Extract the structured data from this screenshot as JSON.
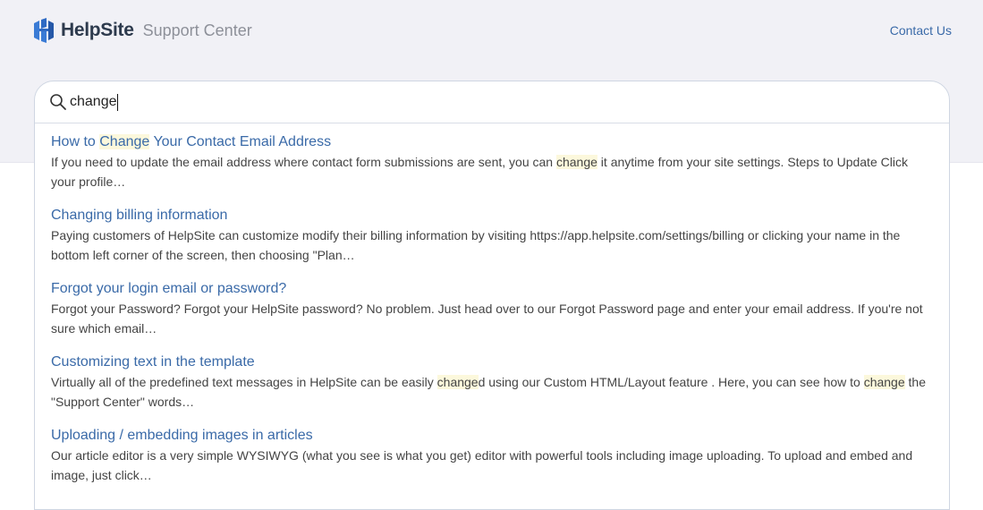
{
  "header": {
    "brand": "HelpSite",
    "subtitle": "Support Center",
    "contact_label": "Contact Us",
    "logo_icon": "helpsite-logo-icon",
    "brand_color": "#2d3a4d",
    "logo_color": "#3a7bd5"
  },
  "search": {
    "value": "change",
    "icon": "search-icon"
  },
  "results": [
    {
      "title": "How to Change Your Contact Email Address",
      "snippet": "If you need to update the email address where contact form submissions are sent, you can change it anytime from your site settings. Steps to Update Click your profile…"
    },
    {
      "title": "Changing billing information",
      "snippet": "Paying customers of HelpSite can customize modify their billing information by visiting https://app.helpsite.com/settings/billing or clicking your name in the bottom left corner of the screen, then choosing \"Plan…"
    },
    {
      "title": "Forgot your login email or password?",
      "snippet": "Forgot your Password? Forgot your HelpSite password? No problem. Just head over to our Forgot Password page and enter your email address. If you're not sure which email…"
    },
    {
      "title": "Customizing text in the template",
      "snippet": "Virtually all of the predefined text messages in HelpSite can be easily changed using our  Custom HTML/Layout feature . Here, you can see how to change the \"Support Center\" words…"
    },
    {
      "title": "Uploading / embedding images in articles",
      "snippet": "Our article editor is a very simple WYSIWYG (what you see is what you get) editor with powerful tools including image uploading. To upload and embed and image, just click…"
    }
  ],
  "colors": {
    "link": "#3a6aa8",
    "highlight": "#fcf8dc",
    "hero_bg": "#f1f1f6"
  }
}
